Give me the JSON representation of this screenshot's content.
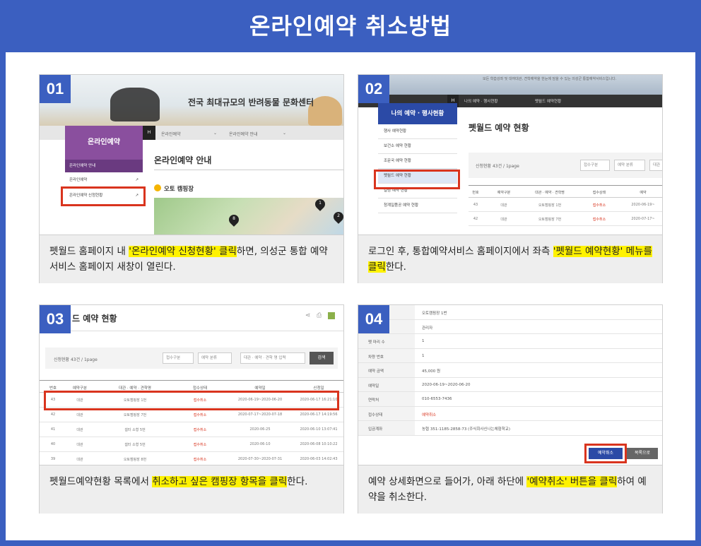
{
  "title": "온라인예약 취소방법",
  "steps": [
    {
      "num": "01",
      "caption_parts": [
        "펫월드 홈페이지 내 ",
        "'온라인예약 신청현황' 클릭",
        "하면, 의성군 통합 예약 서비스 홈페이지 새창이 열린다."
      ],
      "banner_title": "전국 최대규모의 반려동물 문화센터",
      "nav": [
        "H",
        "온라인예약",
        "온라인예약 안내"
      ],
      "side_title": "온라인예약",
      "side_items": [
        "온라인예약 안내",
        "온라인예약",
        "온라인예약 신청현황"
      ],
      "content_title": "온라인예약 안내",
      "sub_title": "오토 캠핑장",
      "map_labels": [
        "1",
        "2",
        "8"
      ]
    },
    {
      "num": "02",
      "caption_parts": [
        "로그인 후, 통합예약서비스 홈페이지에서 좌측 ",
        "'펫월드 예약현황' 메뉴를 클릭",
        "한다."
      ],
      "top_text": "모든 학습강좌 및 대여대관, 견학예약을 한눈에 담을 수 있는 의성군 통합예약서비스입니다.",
      "nav": [
        "H",
        "나의 예약 · 행사현황",
        "펫월드 예약현황"
      ],
      "side_title": "나의 예약 · 행사현황",
      "side_items": [
        "행사 예약현황",
        "보건소 예약 현황",
        "조문국 예약 현황",
        "펫월드 예약 현황",
        "컬링 예약 현황",
        "청계일품공 예약 현황"
      ],
      "content_title": "펫월드 예약 현황",
      "count_text": "신청현황 43건 / 1page",
      "filters": [
        "접수구분",
        "예약 분류",
        "대관"
      ],
      "headers": [
        "번호",
        "예약구분",
        "대관 · 예약 · 견학명",
        "접수상태",
        "예약"
      ],
      "rows": [
        [
          "43",
          "대관",
          "오토캠핑장 1번",
          "접수취소",
          "2020-06-19~"
        ],
        [
          "42",
          "대관",
          "오토캠핑장 7번",
          "접수취소",
          "2020-07-17~"
        ]
      ]
    },
    {
      "num": "03",
      "caption_parts": [
        "펫월드예약현황 목록에서 ",
        "취소하고 싶은 캠핑장 항목을 클릭",
        "한다."
      ],
      "content_title": "드 예약 현황",
      "count_text": "신청현황 43건 / 1page",
      "filters": [
        "접수구분",
        "예약 분류",
        "대관 · 예약 · 견학 명 입력"
      ],
      "search": "검색",
      "headers": [
        "번호",
        "예약구분",
        "대관 · 예약 · 견학명",
        "접수상태",
        "예약일",
        "신청일"
      ],
      "rows": [
        [
          "43",
          "대관",
          "오토캠핑장 1번",
          "접수취소",
          "2020-06-19~2020-06-20",
          "2020-06-17 16:21:10"
        ],
        [
          "42",
          "대관",
          "오토캠핑장 7번",
          "접수취소",
          "2020-07-17~2020-07-18",
          "2020-06-17 14:19:56"
        ],
        [
          "41",
          "대관",
          "쉼터 소형 5번",
          "접수취소",
          "2020-06-25",
          "2020-06-10 13:07:41"
        ],
        [
          "40",
          "대관",
          "쉼터 소형 5번",
          "접수취소",
          "2020-06-10",
          "2020-06-08 10:10:22"
        ],
        [
          "39",
          "대관",
          "오토캠핑장 8번",
          "접수취소",
          "2020-07-30~2020-07-31",
          "2020-06-03 14:02:43"
        ]
      ]
    },
    {
      "num": "04",
      "caption_parts": [
        "예약 상세화면으로 들어가, 아래 하단에 ",
        "'예약취소' 버튼을 클릭",
        "하여 예약을 취소한다."
      ],
      "details": [
        [
          "",
          "오토캠핑장 1번"
        ],
        [
          "",
          "관리자"
        ],
        [
          "펫 마리 수",
          "1"
        ],
        [
          "차량 번호",
          "1"
        ],
        [
          "예약 금액",
          "45,000 원"
        ],
        [
          "예약일",
          "2020-06-19~2020-06-20"
        ],
        [
          "연락처",
          "010-6553-7436"
        ],
        [
          "접수상태",
          "예약취소"
        ],
        [
          "입금계좌",
          "농협 351-1185-2858-73 (주식회사신나는체험학교)"
        ]
      ],
      "cancel_btn": "예약취소",
      "list_btn": "목록으로"
    }
  ]
}
